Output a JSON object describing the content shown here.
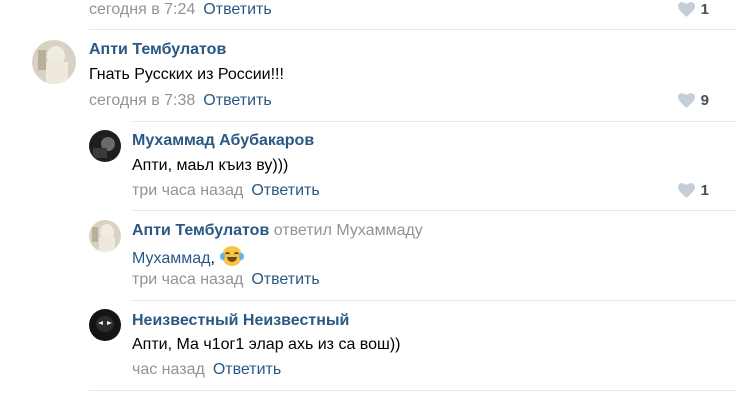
{
  "colors": {
    "link": "#2a5885",
    "meta": "#939393",
    "divider": "#e7e8ec",
    "heart": "#c5cdd7",
    "like_count": "#454f59"
  },
  "comments": [
    {
      "time": "сегодня в 7:24",
      "reply_label": "Ответить",
      "likes": "1",
      "icon": "heart-icon"
    },
    {
      "author": "Апти Тембулатов",
      "text": "Гнать Русских из России!!!",
      "time": "сегодня в 7:38",
      "reply_label": "Ответить",
      "likes": "9",
      "icon": "heart-icon"
    },
    {
      "author": "Мухаммад Абубакаров",
      "text": "Апти, маьл къиз ву)))",
      "time": "три часа назад",
      "reply_label": "Ответить",
      "likes": "1",
      "icon": "heart-icon"
    },
    {
      "author": "Апти Тембулатов",
      "replied_to": "ответил Мухаммаду",
      "mention": "Мухаммад",
      "text_suffix": ",",
      "emoji": "tears-of-joy-emoji",
      "time": "три часа назад",
      "reply_label": "Ответить"
    },
    {
      "author": "Неизвестный Неизвестный",
      "text": "Апти, Ма ч1ог1 элар ахь из са вош))",
      "time": "час назад",
      "reply_label": "Ответить"
    }
  ]
}
